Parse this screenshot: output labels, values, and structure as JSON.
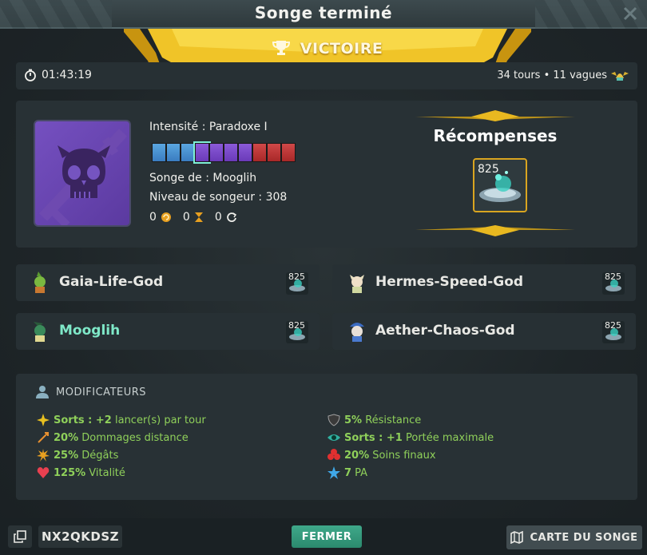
{
  "window": {
    "title": "Songe terminé",
    "result": "VICTOIRE"
  },
  "infobar": {
    "timer": "01:43:19",
    "stats": "34 tours • 11 vagues"
  },
  "dream": {
    "intensity": "Intensité : Paradoxe I",
    "owner": "Songe de : Mooglih",
    "level": "Niveau de songeur : 308",
    "counter_1": "0",
    "counter_2": "0",
    "counter_3": "0",
    "intensity_segments": [
      "blue",
      "blue",
      "blue",
      "purple",
      "purple",
      "purple",
      "purple",
      "red",
      "red",
      "red"
    ],
    "current_segment_index": 3
  },
  "rewards": {
    "title": "Récompenses",
    "count": "825"
  },
  "players": [
    {
      "name": "Gaia-Life-God",
      "reward": "825",
      "highlight": false
    },
    {
      "name": "Hermes-Speed-God",
      "reward": "825",
      "highlight": false
    },
    {
      "name": "Mooglih",
      "reward": "825",
      "highlight": true
    },
    {
      "name": "Aether-Chaos-God",
      "reward": "825",
      "highlight": false
    }
  ],
  "modifiers": {
    "title": "MODIFICATEURS",
    "left": [
      {
        "bold": "Sorts : +2",
        "text": " lancer(s) par tour",
        "icon": "star-burst-icon"
      },
      {
        "bold": "20%",
        "text": " Dommages distance",
        "icon": "arrow-icon"
      },
      {
        "bold": "25%",
        "text": " Dégâts",
        "icon": "explosion-icon"
      },
      {
        "bold": "125%",
        "text": " Vitalité",
        "icon": "heart-icon"
      }
    ],
    "right": [
      {
        "bold": "5%",
        "text": " Résistance",
        "icon": "shield-icon"
      },
      {
        "bold": "Sorts : +1",
        "text": " Portée maximale",
        "icon": "eye-icon"
      },
      {
        "bold": "20%",
        "text": " Soins finaux",
        "icon": "cross-heal-icon"
      },
      {
        "bold": "7",
        "text": " PA",
        "icon": "star-icon"
      }
    ]
  },
  "footer": {
    "code": "NX2QKDSZ",
    "close_label": "FERMER",
    "map_label": "CARTE DU SONGE"
  },
  "colors": {
    "accent_green": "#8fd05a",
    "gold": "#e8b820",
    "teal_button": "#3fa88a"
  }
}
